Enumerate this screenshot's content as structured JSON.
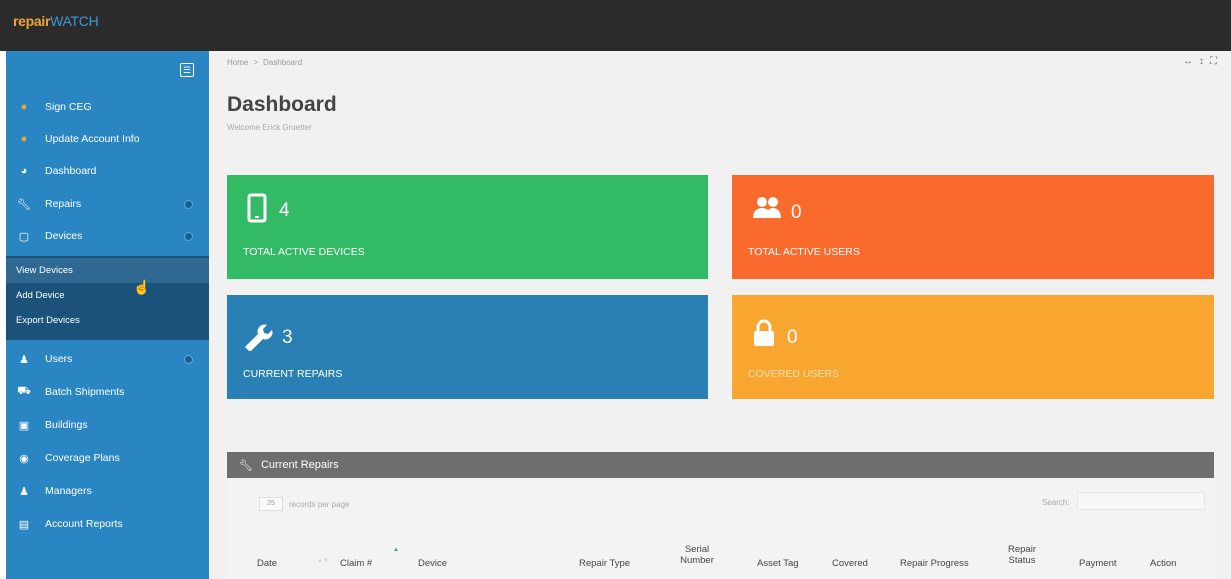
{
  "app": {
    "logo_part1": "repair",
    "logo_part2": "WATCH"
  },
  "sidebar": {
    "toggle_icon": "sidebar-toggle-icon",
    "items": [
      {
        "label": "Sign CEG",
        "icon": "user-icon"
      },
      {
        "label": "Update Account Info",
        "icon": "user-edit-icon"
      },
      {
        "label": "Dashboard",
        "icon": "dashboard-icon"
      },
      {
        "label": "Repairs",
        "icon": "wrench-icon"
      },
      {
        "label": "Devices",
        "icon": "tablet-icon"
      },
      {
        "label": "Users",
        "icon": "users-icon"
      },
      {
        "label": "Batch Shipments",
        "icon": "truck-icon"
      },
      {
        "label": "Buildings",
        "icon": "building-icon"
      },
      {
        "label": "Coverage Plans",
        "icon": "camera-icon"
      },
      {
        "label": "Managers",
        "icon": "person-icon"
      },
      {
        "label": "Account Reports",
        "icon": "bar-chart-icon"
      }
    ],
    "devices_submenu": [
      "View Devices",
      "Add Device",
      "Export Devices"
    ]
  },
  "breadcrumb": {
    "home": "Home",
    "current": "Dashboard"
  },
  "page": {
    "title": "Dashboard",
    "subtitle": "Welcome Erick Gruetter"
  },
  "tiles": [
    {
      "value": "4",
      "label": "TOTAL ACTIVE DEVICES",
      "color": "#32bb64",
      "icon": "tablet-icon"
    },
    {
      "value": "0",
      "label": "TOTAL ACTIVE USERS",
      "color": "#fb6a2d",
      "icon": "users-icon"
    },
    {
      "value": "3",
      "label": "CURRENT REPAIRS",
      "color": "#2a7fb4",
      "icon": "wrench-icon"
    },
    {
      "value": "0",
      "label": "COVERED USERS",
      "color": "#f8a62f",
      "icon": "lock-icon"
    }
  ],
  "repairs_panel": {
    "title": "Current Repairs",
    "page_size": "25",
    "records_label": "records per page",
    "search_label": "Search:",
    "columns": [
      "Date",
      "Claim #",
      "Device",
      "Repair Type",
      "Serial Number",
      "Asset Tag",
      "Covered",
      "Repair Progress",
      "Repair Status",
      "Payment",
      "Action"
    ]
  },
  "colors": {
    "topbar": "#2b2b2b",
    "sidebar": "#2a86c2",
    "submenu": "#1b5279"
  }
}
